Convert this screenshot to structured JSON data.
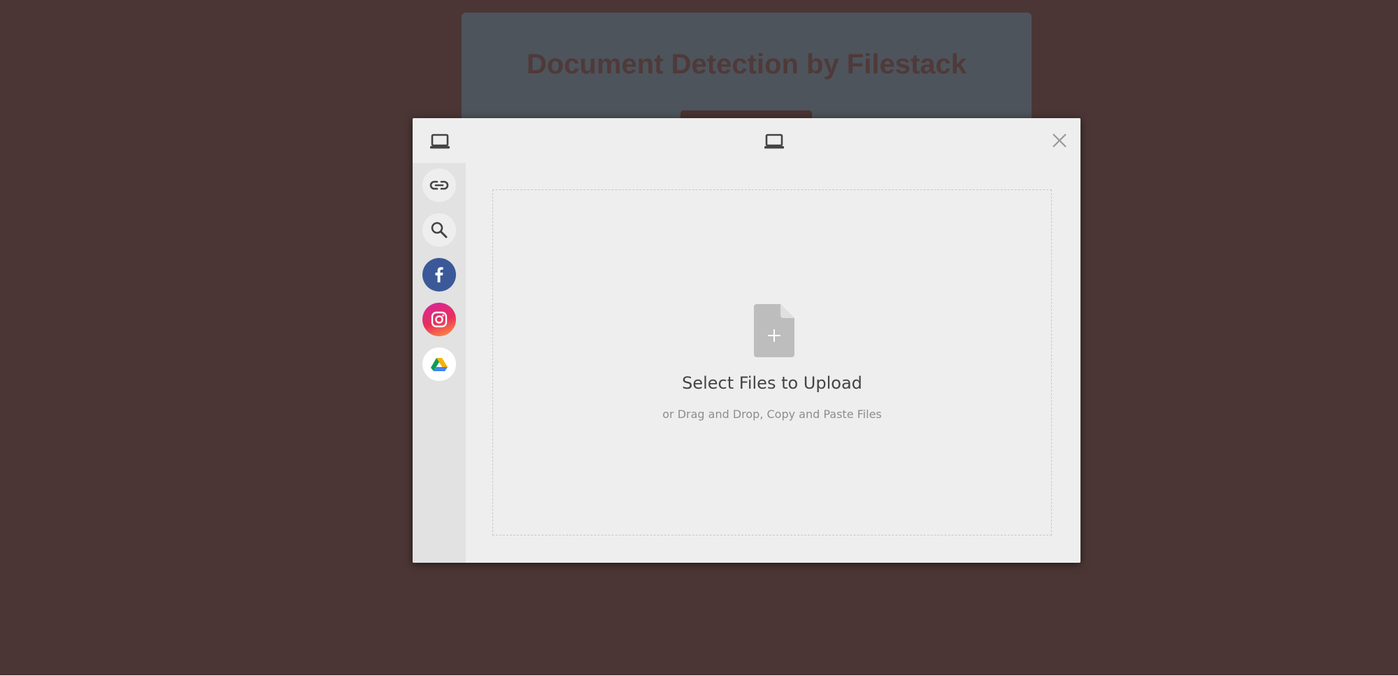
{
  "background_page": {
    "title": "Document Detection by Filestack"
  },
  "picker": {
    "header": {
      "left_icon": "laptop-icon",
      "center_icon": "laptop-icon",
      "close_icon": "close-icon"
    },
    "sources": [
      {
        "name": "link",
        "icon": "link-icon"
      },
      {
        "name": "search",
        "icon": "search-icon"
      },
      {
        "name": "facebook",
        "icon": "facebook-icon",
        "color": "#3b5998"
      },
      {
        "name": "instagram",
        "icon": "instagram-icon",
        "color": "#e1306c"
      },
      {
        "name": "google-drive",
        "icon": "google-drive-icon"
      }
    ],
    "dropzone": {
      "icon": "file-add-icon",
      "title": "Select Files to Upload",
      "subtitle": "or Drag and Drop, Copy and Paste Files"
    }
  },
  "colors": {
    "backdrop": "#4b3635",
    "card": "#4e545c",
    "picker_bg": "#eeeeee",
    "sidebar_bg": "#e2e2e2"
  }
}
